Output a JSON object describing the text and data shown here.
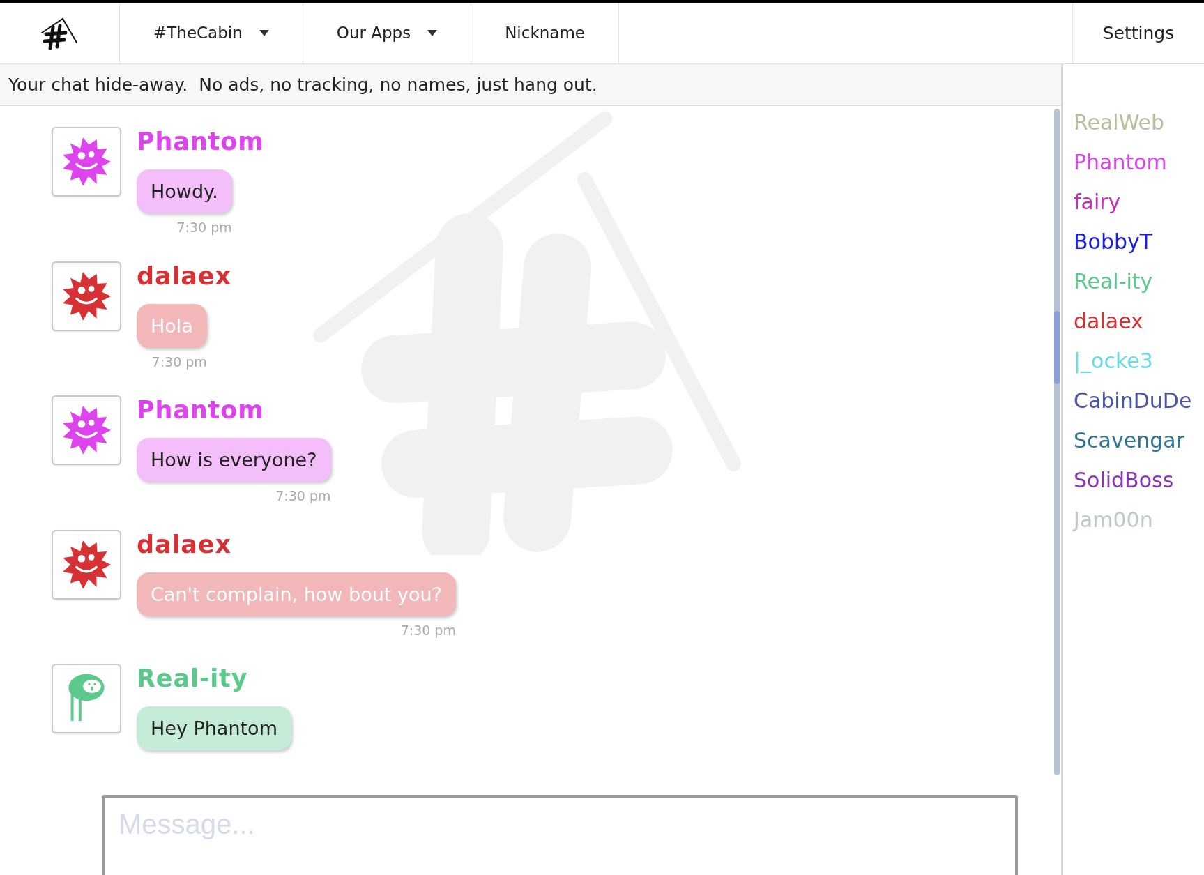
{
  "nav": {
    "items": [
      {
        "label": "#TheCabin",
        "dropdown": true
      },
      {
        "label": "Our Apps",
        "dropdown": true
      },
      {
        "label": "Nickname",
        "dropdown": false
      }
    ],
    "settings": "Settings"
  },
  "tagline": "Your chat hide-away.  No ads, no tracking, no names, just hang out.",
  "messages": [
    {
      "user": "Phantom",
      "color": "#dd44ee",
      "kind": "splat",
      "text": "Howdy.",
      "light_text": false,
      "time": "7:30 pm"
    },
    {
      "user": "dalaex",
      "color": "#d63236",
      "kind": "splat",
      "text": "Hola",
      "light_text": true,
      "time": "7:30 pm"
    },
    {
      "user": "Phantom",
      "color": "#dd44ee",
      "kind": "splat",
      "text": "How is everyone?",
      "light_text": false,
      "time": "7:30 pm"
    },
    {
      "user": "dalaex",
      "color": "#d63236",
      "kind": "splat",
      "text": "Can't complain, how bout you?",
      "light_text": true,
      "time": "7:30 pm"
    },
    {
      "user": "Real-ity",
      "color": "#5ac98a",
      "kind": "blob",
      "text": "Hey Phantom",
      "light_text": false
    }
  ],
  "message_input": {
    "placeholder": "Message..."
  },
  "users": [
    {
      "name": "RealWeb",
      "color": "#b5c0a0"
    },
    {
      "name": "Phantom",
      "color": "#dd44ee"
    },
    {
      "name": "fairy",
      "color": "#c42fb8"
    },
    {
      "name": "BobbyT",
      "color": "#1a1ee0"
    },
    {
      "name": "Real-ity",
      "color": "#5ac98a"
    },
    {
      "name": "dalaex",
      "color": "#d63236"
    },
    {
      "name": "|_ocke3",
      "color": "#66dde6"
    },
    {
      "name": "CabinDuDe",
      "color": "#4d55a8"
    },
    {
      "name": "Scavengar",
      "color": "#2e7595"
    },
    {
      "name": "SolidBoss",
      "color": "#8a35b8"
    },
    {
      "name": "Jam00n",
      "color": "#bfcacd"
    }
  ]
}
